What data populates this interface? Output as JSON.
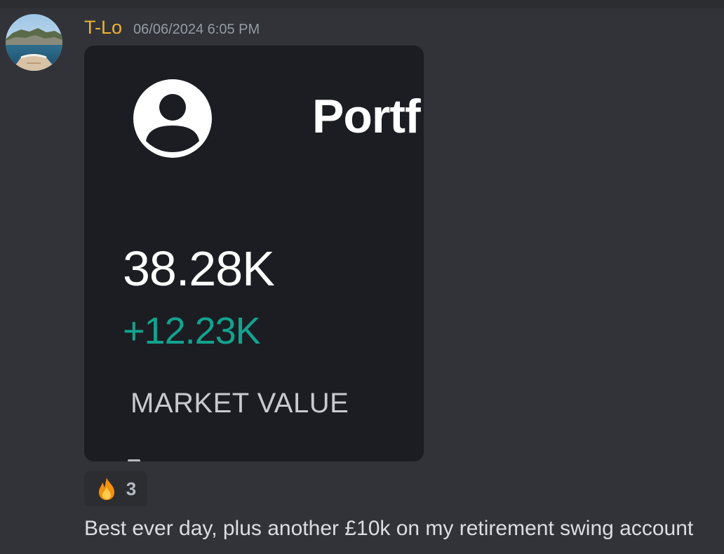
{
  "message": {
    "author": "T-Lo",
    "timestamp": "06/06/2024 6:05 PM",
    "content": "Best ever day, plus another £10k on my retirement swing account",
    "attachment": {
      "title": "Portf",
      "market_value": "38.28K",
      "gain": "+12.23K",
      "label": "MARKET VALUE"
    },
    "reaction": {
      "emoji": "fire-emoji",
      "count": "3"
    }
  },
  "colors": {
    "background": "#313338",
    "username": "#f0b232",
    "timestamp": "#949ba4",
    "text": "#dbdee1",
    "gain_green": "#12a38f",
    "attachment_bg": "#1c1d22",
    "reaction_bg": "#2b2d31"
  }
}
